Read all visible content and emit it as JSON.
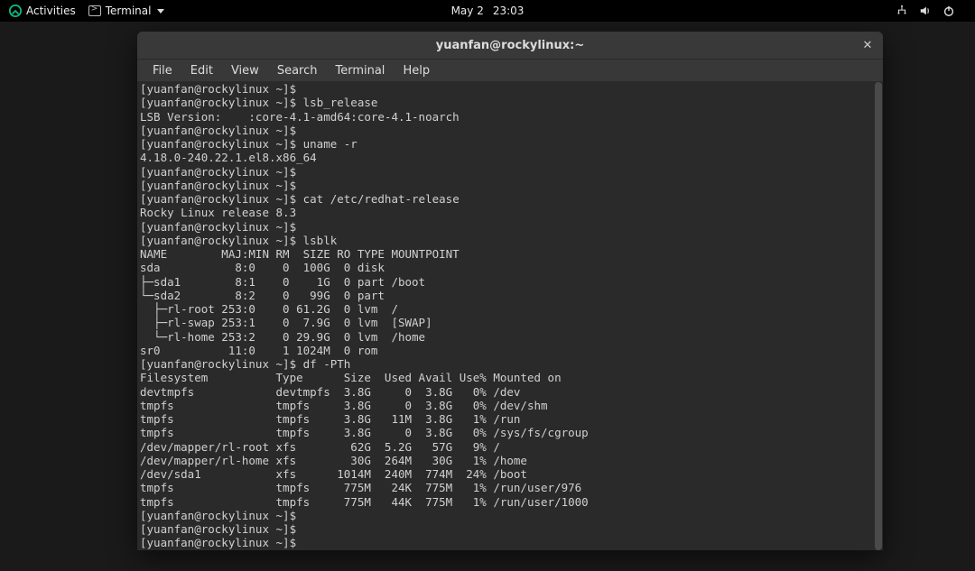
{
  "topbar": {
    "activities": "Activities",
    "terminal": "Terminal",
    "date": "May 2",
    "time": "23:03"
  },
  "window": {
    "title": "yuanfan@rockylinux:~",
    "close": "✕"
  },
  "menubar": {
    "file": "File",
    "edit": "Edit",
    "view": "View",
    "search": "Search",
    "terminal": "Terminal",
    "help": "Help"
  },
  "prompt_base": "[yuanfan@rockylinux ~]$",
  "cmds": {
    "lsb_release": "lsb_release",
    "uname": "uname -r",
    "cat": "cat /etc/redhat-release",
    "lsblk": "lsblk",
    "df": "df -PTh"
  },
  "out": {
    "lsb_release": "LSB Version:    :core-4.1-amd64:core-4.1-noarch",
    "uname": "4.18.0-240.22.1.el8.x86_64",
    "cat": "Rocky Linux release 8.3",
    "lsblk_header": "NAME        MAJ:MIN RM  SIZE RO TYPE MOUNTPOINT",
    "lsblk_sda": "sda           8:0    0  100G  0 disk ",
    "lsblk_sda1": "├─sda1        8:1    0    1G  0 part /boot",
    "lsblk_sda2": "└─sda2        8:2    0   99G  0 part ",
    "lsblk_rl_root": "  ├─rl-root 253:0    0 61.2G  0 lvm  /",
    "lsblk_rl_swap": "  ├─rl-swap 253:1    0  7.9G  0 lvm  [SWAP]",
    "lsblk_rl_home": "  └─rl-home 253:2    0 29.9G  0 lvm  /home",
    "lsblk_sr0": "sr0          11:0    1 1024M  0 rom  ",
    "df_header": "Filesystem          Type      Size  Used Avail Use% Mounted on",
    "df_r0": "devtmpfs            devtmpfs  3.8G     0  3.8G   0% /dev",
    "df_r1": "tmpfs               tmpfs     3.8G     0  3.8G   0% /dev/shm",
    "df_r2": "tmpfs               tmpfs     3.8G   11M  3.8G   1% /run",
    "df_r3": "tmpfs               tmpfs     3.8G     0  3.8G   0% /sys/fs/cgroup",
    "df_r4": "/dev/mapper/rl-root xfs        62G  5.2G   57G   9% /",
    "df_r5": "/dev/mapper/rl-home xfs        30G  264M   30G   1% /home",
    "df_r6": "/dev/sda1           xfs      1014M  240M  774M  24% /boot",
    "df_r7": "tmpfs               tmpfs     775M   24K  775M   1% /run/user/976",
    "df_r8": "tmpfs               tmpfs     775M   44K  775M   1% /run/user/1000"
  }
}
